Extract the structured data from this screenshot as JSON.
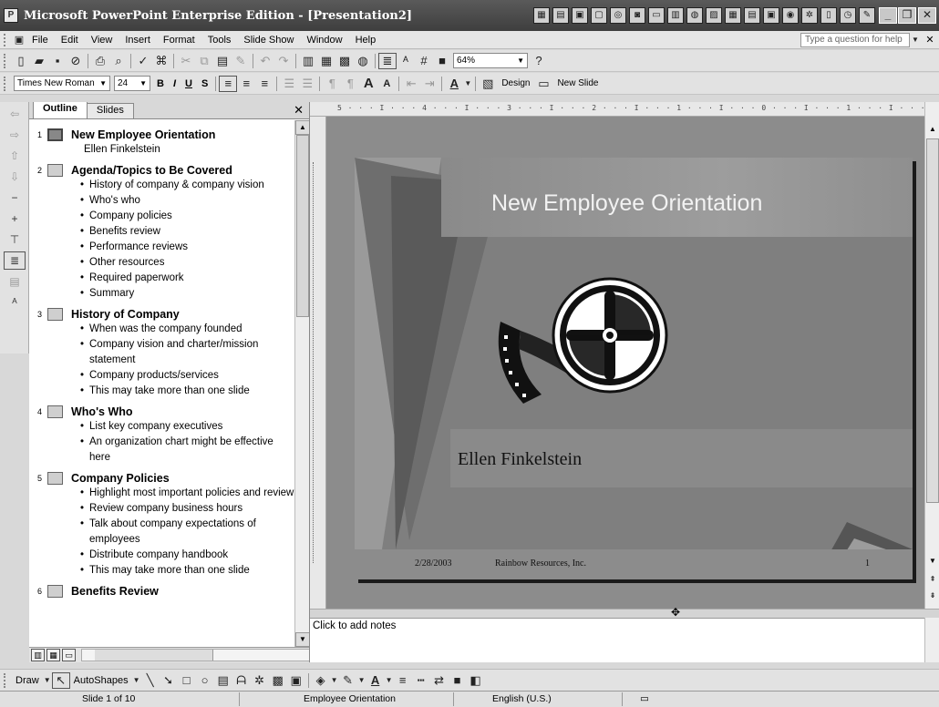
{
  "window": {
    "title": "Microsoft PowerPoint Enterprise Edition - [Presentation2]",
    "tray_icons": [
      "grid-icon",
      "chart-icon",
      "image-icon",
      "window-icon",
      "settings-icon",
      "camera-icon",
      "monitor-icon",
      "film-icon",
      "globe-icon",
      "photo-icon",
      "calendar-icon",
      "table-icon",
      "box-icon",
      "disc-icon",
      "gear-icon",
      "doc-icon",
      "clock-icon",
      "tool-icon"
    ]
  },
  "menubar": {
    "items": [
      "File",
      "Edit",
      "View",
      "Insert",
      "Format",
      "Tools",
      "Slide Show",
      "Window",
      "Help"
    ],
    "help_placeholder": "Type a question for help"
  },
  "standard_toolbar": {
    "zoom": "64%"
  },
  "formatting_toolbar": {
    "font": "Times New Roman",
    "size": "24",
    "bold": "B",
    "italic": "I",
    "underline": "U",
    "shadow": "S",
    "design_label": "Design",
    "new_slide_label": "New Slide"
  },
  "outline_pane": {
    "tabs": [
      "Outline",
      "Slides"
    ],
    "slides": [
      {
        "number": "1",
        "title": "New Employee Orientation",
        "subtitle": "Ellen Finkelstein",
        "bullets": []
      },
      {
        "number": "2",
        "title": "Agenda/Topics to Be Covered",
        "subtitle": "",
        "bullets": [
          "History of company & company vision",
          "Who's who",
          "Company policies",
          "Benefits review",
          "Performance reviews",
          "Other resources",
          "Required paperwork",
          "Summary"
        ]
      },
      {
        "number": "3",
        "title": "History of Company",
        "subtitle": "",
        "bullets": [
          "When was the company founded",
          "Company vision and charter/mission statement",
          "Company products/services",
          "This may take more than one slide"
        ]
      },
      {
        "number": "4",
        "title": "Who's Who",
        "subtitle": "",
        "bullets": [
          "List key company executives",
          "An organization chart might be effective here"
        ]
      },
      {
        "number": "5",
        "title": "Company Policies",
        "subtitle": "",
        "bullets": [
          "Highlight most important policies and review",
          "Review company business hours",
          "Talk about company expectations of employees",
          "Distribute company handbook",
          "This may take more than one slide"
        ]
      },
      {
        "number": "6",
        "title": "Benefits Review",
        "subtitle": "",
        "bullets": []
      }
    ]
  },
  "rulers": {
    "horizontal": "5 · · · I · · · 4 · · · I · · · 3 · · · I · · · 2 · · · I · · · 1 · · · I · · · 0 · · · I · · · 1 · · · I · · · 2 · · · I · · · 3 · · · I · · · 4 · · · I · · ·"
  },
  "slide": {
    "title": "New Employee Orientation",
    "subtitle": "Ellen Finkelstein",
    "date": "2/28/2003",
    "company": "Rainbow Resources, Inc.",
    "number": "1"
  },
  "notes": {
    "placeholder": "Click to add notes"
  },
  "drawing_toolbar": {
    "draw_label": "Draw",
    "autoshapes_label": "AutoShapes"
  },
  "statusbar": {
    "slide_position": "Slide 1 of 10",
    "design": "Employee Orientation",
    "language": "English (U.S.)"
  }
}
